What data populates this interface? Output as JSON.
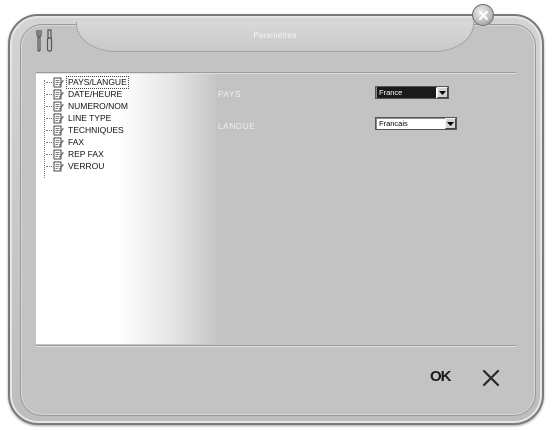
{
  "window": {
    "title": "Paramètres",
    "icons": {
      "tool": "tools-icon",
      "close": "close-icon"
    }
  },
  "tree": {
    "selected": "PAYS/LANGUE",
    "items": [
      {
        "label": "PAYS/LANGUE"
      },
      {
        "label": "DATE/HEURE"
      },
      {
        "label": "NUMERO/NOM"
      },
      {
        "label": "LINE TYPE"
      },
      {
        "label": "TECHNIQUES"
      },
      {
        "label": "FAX"
      },
      {
        "label": "REP FAX"
      },
      {
        "label": "VERROU"
      }
    ]
  },
  "form": {
    "country": {
      "label": "PAYS",
      "value": "France"
    },
    "language": {
      "label": "LANGUE",
      "value": "Francais"
    }
  },
  "actions": {
    "ok_label": "OK"
  },
  "colors": {
    "frame": "#c3c3c3",
    "selected_field_bg": "#1a1a1a"
  }
}
